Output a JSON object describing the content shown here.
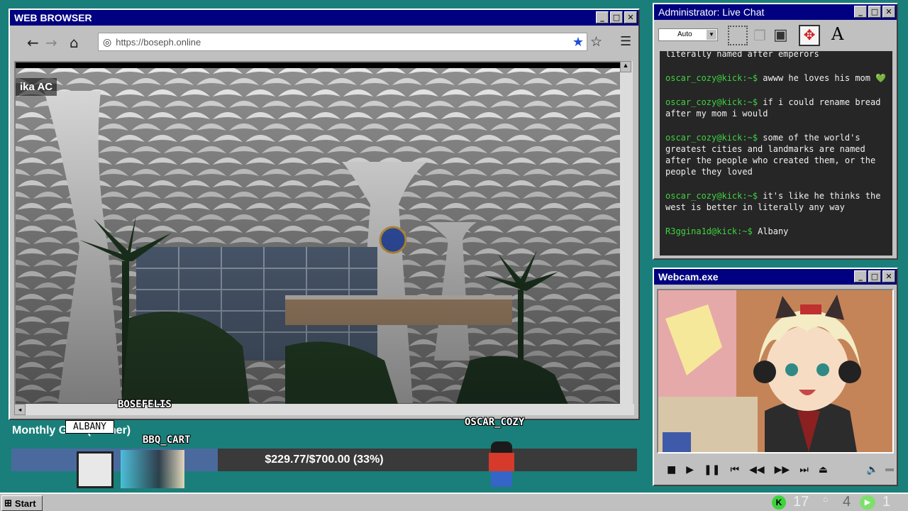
{
  "browser": {
    "title": "WEB BROWSER",
    "url": "https://boseph.online",
    "overlay_text": "ika AC"
  },
  "chat": {
    "title": "Administrator: Live Chat",
    "font_select": "Auto",
    "messages": [
      {
        "user": "",
        "text": "literally named after emperors"
      },
      {
        "user": "oscar_cozy@kick:~$",
        "text": "awww he loves his mom 💚"
      },
      {
        "user": "oscar_cozy@kick:~$",
        "text": "if i could rename bread after my mom i would"
      },
      {
        "user": "oscar_cozy@kick:~$",
        "text": "some of the world's greatest cities and landmarks are named after the people who created them, or the people they loved"
      },
      {
        "user": "oscar_cozy@kick:~$",
        "text": "it's like he thinks the west is better in literally any way"
      },
      {
        "user": "R3ggina1d@kick:~$",
        "text": "Albany"
      }
    ]
  },
  "webcam": {
    "title": "Webcam.exe"
  },
  "goal": {
    "label": "Monthly Goal (Gamer)",
    "progress_text": "$229.77/$700.00 (33%)",
    "progress_fraction": 0.33
  },
  "avatars": {
    "bosefelis": "BOSEFELIS",
    "albany": "ALBANY",
    "bbq_cart": "BBQ_CART",
    "oscar_cozy": "OSCAR_COZY"
  },
  "taskbar": {
    "start_label": "Start",
    "viewers": "17",
    "followers": "4",
    "third_count": "1"
  },
  "colors": {
    "desktop": "#1a7f7a",
    "title_blue": "#000080",
    "chat_green": "#3ed33e",
    "goal_fill": "#4a6a9e"
  }
}
